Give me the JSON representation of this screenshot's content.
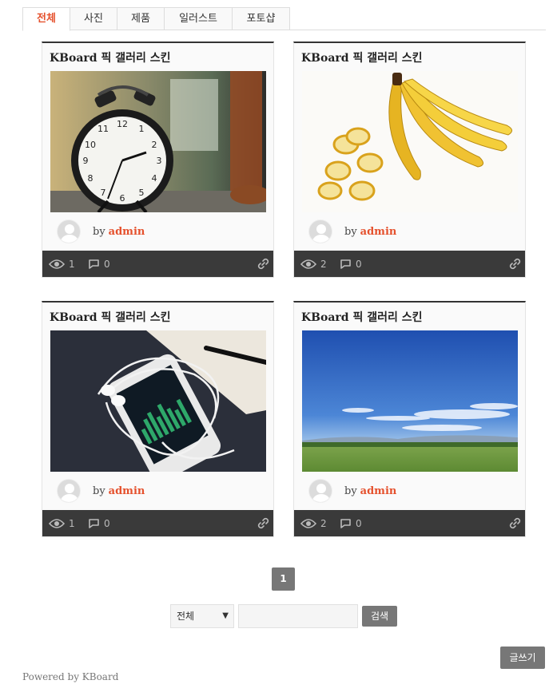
{
  "tabs": [
    {
      "label": "전체",
      "active": true
    },
    {
      "label": "사진",
      "active": false
    },
    {
      "label": "제품",
      "active": false
    },
    {
      "label": "일러스트",
      "active": false
    },
    {
      "label": "포토샵",
      "active": false
    }
  ],
  "cards": [
    {
      "title": "KBoard 픽 갤러리 스킨",
      "by": "by",
      "author": "admin",
      "views": "1",
      "comments": "0",
      "image": "alarm-clock"
    },
    {
      "title": "KBoard 픽 갤러리 스킨",
      "by": "by",
      "author": "admin",
      "views": "2",
      "comments": "0",
      "image": "bananas"
    },
    {
      "title": "KBoard 픽 갤러리 스킨",
      "by": "by",
      "author": "admin",
      "views": "1",
      "comments": "0",
      "image": "smartphone-earphones"
    },
    {
      "title": "KBoard 픽 갤러리 스킨",
      "by": "by",
      "author": "admin",
      "views": "2",
      "comments": "0",
      "image": "sky-field"
    }
  ],
  "pagination": {
    "current": "1"
  },
  "search": {
    "select_value": "전체",
    "input_value": "",
    "button_label": "검색"
  },
  "write_button": "글쓰기",
  "footer": {
    "powered": "Powered by KBoard"
  },
  "colors": {
    "accent": "#e5512d",
    "footer_bar": "#3a3a3a",
    "button": "#777777"
  }
}
